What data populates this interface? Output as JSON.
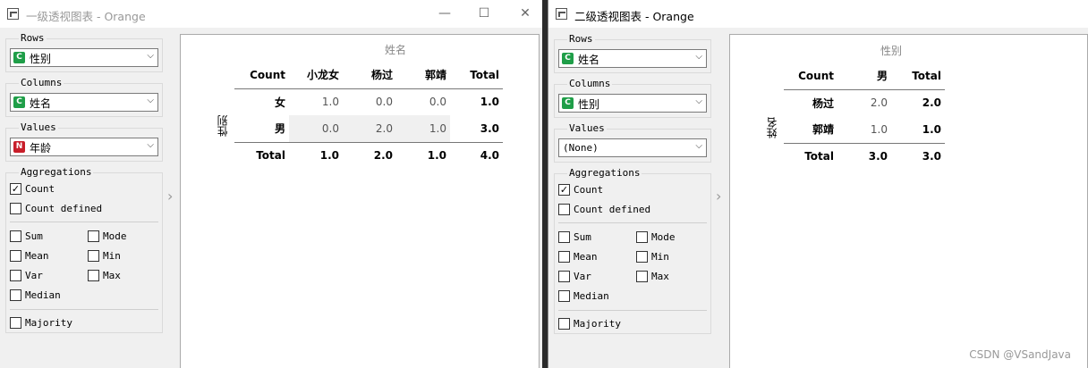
{
  "windows": [
    {
      "title": "一级透视图表 - Orange",
      "titlebar_buttons": [
        "—",
        "☐",
        "✕"
      ],
      "rows": {
        "label": "Rows",
        "value": "性别",
        "badge": "C",
        "badge_color": "#1f9e48"
      },
      "columns": {
        "label": "Columns",
        "value": "姓名",
        "badge": "C",
        "badge_color": "#1f9e48"
      },
      "values": {
        "label": "Values",
        "value": "年龄",
        "badge": "N",
        "badge_color": "#c81e2a"
      },
      "aggregations": {
        "label": "Aggregations",
        "count": "Count",
        "count_checked": "✓",
        "count_defined": "Count defined",
        "sum": "Sum",
        "mode": "Mode",
        "mean": "Mean",
        "min": "Min",
        "var": "Var",
        "max": "Max",
        "median": "Median",
        "majority": "Majority"
      },
      "splitter": "›",
      "table": {
        "col_header": "姓名",
        "row_header": "性别",
        "corner": "Count",
        "columns": [
          "小龙女",
          "杨过",
          "郭靖",
          "Total"
        ],
        "rows": [
          {
            "label": "女",
            "values": [
              "1.0",
              "0.0",
              "0.0",
              "1.0"
            ]
          },
          {
            "label": "男",
            "values": [
              "0.0",
              "2.0",
              "1.0",
              "3.0"
            ]
          }
        ],
        "total": {
          "label": "Total",
          "values": [
            "1.0",
            "2.0",
            "1.0",
            "4.0"
          ]
        }
      }
    },
    {
      "title": "二级透视图表 - Orange",
      "rows": {
        "label": "Rows",
        "value": "姓名",
        "badge": "C",
        "badge_color": "#1f9e48"
      },
      "columns": {
        "label": "Columns",
        "value": "性别",
        "badge": "C",
        "badge_color": "#1f9e48"
      },
      "values": {
        "label": "Values",
        "value": "(None)"
      },
      "aggregations": {
        "label": "Aggregations",
        "count": "Count",
        "count_checked": "✓",
        "count_defined": "Count defined",
        "sum": "Sum",
        "mode": "Mode",
        "mean": "Mean",
        "min": "Min",
        "var": "Var",
        "max": "Max",
        "median": "Median",
        "majority": "Majority"
      },
      "splitter": "›",
      "table": {
        "col_header": "性别",
        "row_header": "姓名",
        "corner": "Count",
        "columns": [
          "男",
          "Total"
        ],
        "rows": [
          {
            "label": "杨过",
            "values": [
              "2.0",
              "2.0"
            ]
          },
          {
            "label": "郭靖",
            "values": [
              "1.0",
              "1.0"
            ]
          }
        ],
        "total": {
          "label": "Total",
          "values": [
            "3.0",
            "3.0"
          ]
        }
      }
    }
  ],
  "watermark": "CSDN @VSandJava",
  "combo_arrow": "⌵"
}
